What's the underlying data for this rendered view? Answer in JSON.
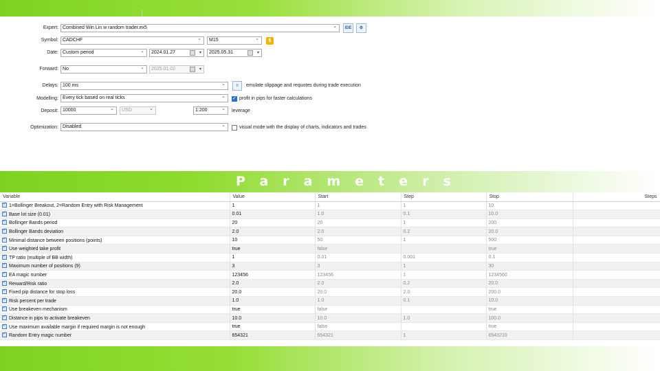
{
  "settings": {
    "expert": {
      "label": "Expert:",
      "value": "Combined Win Lin w random trader.ex5",
      "ide_button": "IDE"
    },
    "symbol": {
      "label": "Symbol:",
      "value": "CADCHF",
      "timeframe": "M15"
    },
    "date": {
      "label": "Date:",
      "value": "Custom period",
      "from": "2024.01.27",
      "to": "2025.05.31"
    },
    "forward": {
      "label": "Forward:",
      "value": "No",
      "date": "2025.01.02"
    },
    "delays": {
      "label": "Delays:",
      "value": "100 ms",
      "note": "emulate slippage and requotes during trade execution"
    },
    "modelling": {
      "label": "Modelling:",
      "value": "Every tick based on real ticks",
      "note": "profit in pips for faster calculations"
    },
    "deposit": {
      "label": "Deposit:",
      "value": "10000",
      "currency": "USD",
      "leverage_value": "1:200",
      "leverage_label": "leverage"
    },
    "optimization": {
      "label": "Optimization:",
      "value": "Disabled",
      "note": "visual mode with the display of charts, indicators and trades"
    }
  },
  "banner": {
    "title": "Parameters"
  },
  "table": {
    "headers": {
      "variable": "Variable",
      "value": "Value",
      "start": "Start",
      "step": "Step",
      "stop": "Stop",
      "steps": "Steps"
    },
    "rows": [
      {
        "variable": "1=Bollinger Breakout, 2=Random Entry with Risk Management",
        "value": "1",
        "start": "1",
        "step": "1",
        "stop": "10"
      },
      {
        "variable": "Base lot size (0.01)",
        "value": "0.01",
        "start": "1.0",
        "step": "0.1",
        "stop": "10.0"
      },
      {
        "variable": "Bollinger Bands period",
        "value": "20",
        "start": "20",
        "step": "1",
        "stop": "200"
      },
      {
        "variable": "Bollinger Bands deviation",
        "value": "2.0",
        "start": "2.0",
        "step": "0.2",
        "stop": "20.0"
      },
      {
        "variable": "Minimal distance between positions (points)",
        "value": "10",
        "start": "50",
        "step": "1",
        "stop": "500"
      },
      {
        "variable": "Use weighted take profit",
        "value": "true",
        "start": "false",
        "step": "",
        "stop": "true"
      },
      {
        "variable": "TP ratio (multiple of BB width)",
        "value": "1",
        "start": "0.01",
        "step": "0.001",
        "stop": "0.1"
      },
      {
        "variable": "Maximum number of positions (9)",
        "value": "3",
        "start": "3",
        "step": "1",
        "stop": "30"
      },
      {
        "variable": "EA magic number",
        "value": "123456",
        "start": "123456",
        "step": "1",
        "stop": "1234560"
      },
      {
        "variable": "Reward/Risk ratio",
        "value": "2.0",
        "start": "2.0",
        "step": "0.2",
        "stop": "20.0"
      },
      {
        "variable": "Fixed pip distance for stop loss",
        "value": "20.0",
        "start": "20.0",
        "step": "2.0",
        "stop": "200.0"
      },
      {
        "variable": "Risk percent per trade",
        "value": "1.0",
        "start": "1.0",
        "step": "0.1",
        "stop": "10.0"
      },
      {
        "variable": "Use breakeven mechanism",
        "value": "true",
        "start": "false",
        "step": "",
        "stop": "true"
      },
      {
        "variable": "Distance in pips to activate breakeven",
        "value": "10.0",
        "start": "10.0",
        "step": "1.0",
        "stop": "100.0"
      },
      {
        "variable": "Use maximum available margin if required margin is not enough",
        "value": "true",
        "start": "false",
        "step": "",
        "stop": "true"
      },
      {
        "variable": "Random Entry magic number",
        "value": "654321",
        "start": "654321",
        "step": "1",
        "stop": "6543210"
      }
    ]
  },
  "colors": {
    "accent_green": "#7ed321",
    "checkbox_blue": "#2f6fd0"
  }
}
